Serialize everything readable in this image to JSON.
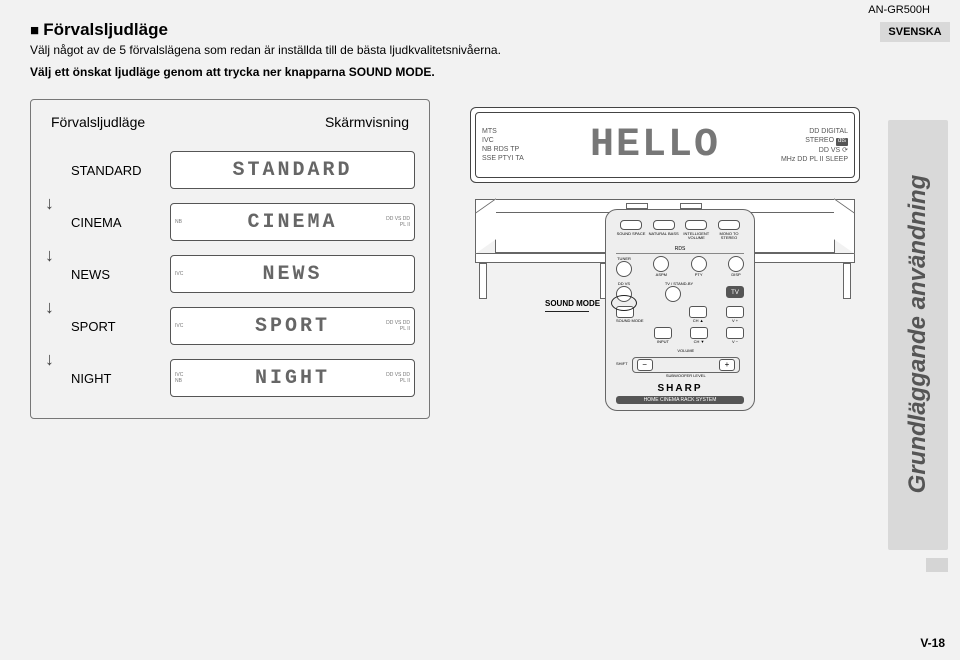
{
  "product_code": "AN-GR500H",
  "language_tab": "SVENSKA",
  "side_tab": "Grundläggande användning",
  "page_number": "V-18",
  "section": {
    "title": "Förvalsljudläge",
    "intro": "Välj något av de 5 förvalslägena som redan är inställda till de bästa ljudkvalitetsnivåerna.",
    "instruction": "Välj ett önskat ljudläge genom att trycka ner knapparna SOUND MODE."
  },
  "modes_panel": {
    "col1": "Förvalsljudläge",
    "col2": "Skärmvisning",
    "rows": [
      {
        "label": "STANDARD",
        "seg": "STANDARD",
        "tag_l": "",
        "tag_r": ""
      },
      {
        "label": "CINEMA",
        "seg": "CINEMA",
        "tag_l": "NB",
        "tag_r": "DD VS  DD PL II"
      },
      {
        "label": "NEWS",
        "seg": "NEWS",
        "tag_l": "IVC",
        "tag_r": ""
      },
      {
        "label": "SPORT",
        "seg": "SPORT",
        "tag_l": "IVC",
        "tag_r": "DD VS  DD PL II"
      },
      {
        "label": "NIGHT",
        "seg": "NIGHT",
        "tag_l": "IVC NB",
        "tag_r": "DD VS  DD PL II"
      }
    ]
  },
  "main_display": {
    "seg": "HELLO",
    "ind_left": [
      "MTS",
      "IVC",
      "NB  RDS TP",
      "SSE PTYI TA"
    ],
    "ind_right": [
      "DD DIGITAL",
      "STEREO",
      "DD VS  ⟳",
      "MHz DD PL II SLEEP"
    ],
    "dts_label": "dts"
  },
  "remote": {
    "callout": "SOUND MODE",
    "row1": [
      "SOUND SPACE",
      "NATURAL BASS",
      "INTELLIGENT VOLUME",
      "MONO TO STEREO"
    ],
    "rds_header": "RDS",
    "row2_left": "TUNER",
    "row2": [
      "ASPM",
      "PTY",
      "DISP"
    ],
    "row3_left": "DD VS",
    "row3_center": "TV / STAND-BY",
    "row3_right": "TV",
    "row4": [
      "SOUND MODE",
      "INPUT",
      "CH ▲",
      "V +",
      "CH ▼",
      "V −"
    ],
    "shift": "SHIFT",
    "volume_label": "VOLUME",
    "sub_label": "SUBWOOFER LEVEL",
    "brand": "SHARP",
    "strip": "HOME CINEMA RACK SYSTEM"
  }
}
